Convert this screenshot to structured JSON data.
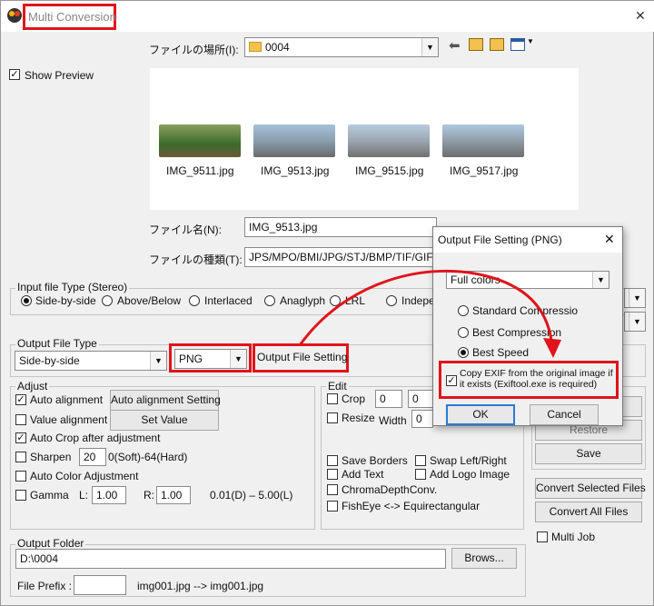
{
  "window": {
    "title": "Multi Conversion",
    "close_glyph": "✕"
  },
  "file_browser": {
    "location_label": "ファイルの場所(I):",
    "location_value": "0004",
    "show_preview_label": "Show Preview",
    "files": [
      "IMG_9511.jpg",
      "IMG_9513.jpg",
      "IMG_9515.jpg",
      "IMG_9517.jpg"
    ],
    "filename_label": "ファイル名(N):",
    "filename_value": "IMG_9513.jpg",
    "filetype_label": "ファイルの種類(T):",
    "filetype_value": "JPS/MPO/BMI/JPG/STJ/BMP/TIF/GIF/P"
  },
  "input_type": {
    "title": "Input file Type (Stereo)",
    "options": [
      "Side-by-side",
      "Above/Below",
      "Interlaced",
      "Anaglyph",
      "LRL",
      "Indepe"
    ]
  },
  "output_type": {
    "title": "Output File Type",
    "layout_value": "Side-by-side",
    "format_value": "PNG",
    "setting_button": "Output File Setting"
  },
  "adjust": {
    "title": "Adjust",
    "auto_alignment": "Auto alignment",
    "auto_alignment_setting": "Auto alignment Setting",
    "value_alignment": "Value alignment",
    "set_value": "Set Value",
    "auto_crop": "Auto Crop after adjustment",
    "sharpen": "Sharpen",
    "sharpen_value": "20",
    "sharpen_range": "0(Soft)-64(Hard)",
    "auto_color": "Auto Color Adjustment",
    "gamma": "Gamma",
    "gamma_l_label": "L:",
    "gamma_l": "1.00",
    "gamma_r_label": "R:",
    "gamma_r": "1.00",
    "gamma_range": "0.01(D) – 5.00(L)"
  },
  "edit": {
    "title": "Edit",
    "crop": "Crop",
    "crop_v1": "0",
    "crop_v2": "0",
    "resize": "Resize",
    "width_label": "Width",
    "width_value": "0",
    "save_borders": "Save Borders",
    "swap": "Swap Left/Right",
    "add_text": "Add Text",
    "add_logo": "Add Logo Image",
    "chromadepth": "ChromaDepthConv.",
    "fisheye": "FishEye <-> Equirectangular"
  },
  "right_panel": {
    "restore": "Restore",
    "save": "Save",
    "convert_selected": "Convert Selected Files",
    "convert_all": "Convert All Files",
    "multi_job": "Multi Job"
  },
  "output_folder": {
    "title": "Output Folder",
    "path": "D:\\0004",
    "browse": "Brows...",
    "prefix_label": "File Prefix :",
    "prefix_value": "",
    "prefix_example": "img001.jpg --> img001.jpg"
  },
  "dialog": {
    "title": "Output File Setting (PNG)",
    "close_glyph": "✕",
    "color_mode": "Full colors",
    "options": [
      "Standard Compressio",
      "Best Compression",
      "Best Speed"
    ],
    "selected_option": 2,
    "copy_exif": "Copy EXIF from the original image if it exists  (Exiftool.exe is required)",
    "ok": "OK",
    "cancel": "Cancel"
  },
  "colors": {
    "highlight": "#e0141b",
    "accent": "#2a7ad4"
  },
  "icons": [
    "app-icon",
    "folder-icon",
    "back-arrow-icon",
    "up-folder-icon",
    "new-folder-icon",
    "view-menu-icon",
    "checkmark-icon",
    "chevron-down-icon",
    "close-icon",
    "arrow-annotation"
  ]
}
